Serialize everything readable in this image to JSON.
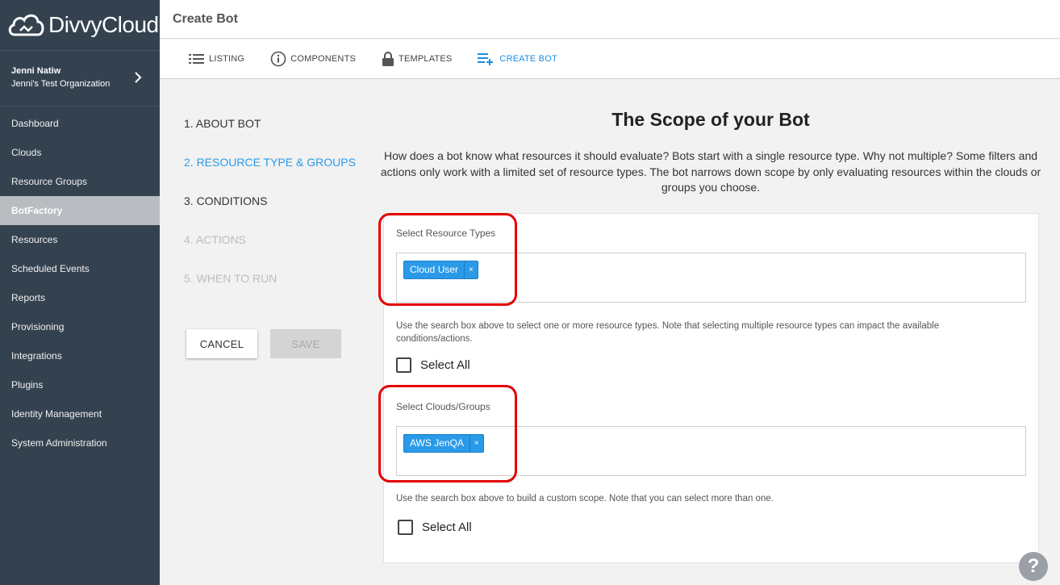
{
  "sidebar": {
    "logo_text": "DivvyCloud",
    "user_name": "Jenni Natiw",
    "user_org": "Jenni's Test Organization",
    "nav": [
      {
        "label": "Dashboard"
      },
      {
        "label": "Clouds"
      },
      {
        "label": "Resource Groups"
      },
      {
        "label": "BotFactory"
      },
      {
        "label": "Resources"
      },
      {
        "label": "Scheduled Events"
      },
      {
        "label": "Reports"
      },
      {
        "label": "Provisioning"
      },
      {
        "label": "Integrations"
      },
      {
        "label": "Plugins"
      },
      {
        "label": "Identity Management"
      },
      {
        "label": "System Administration"
      }
    ],
    "active_item": "BotFactory"
  },
  "header": {
    "title": "Create Bot"
  },
  "tabs": [
    {
      "label": "LISTING",
      "icon": "list-icon"
    },
    {
      "label": "COMPONENTS",
      "icon": "info-icon"
    },
    {
      "label": "TEMPLATES",
      "icon": "lock-icon"
    },
    {
      "label": "CREATE BOT",
      "icon": "add-list-icon"
    }
  ],
  "active_tab": "CREATE BOT",
  "steps": [
    {
      "label": "1. ABOUT BOT",
      "state": "done"
    },
    {
      "label": "2. RESOURCE TYPE & GROUPS",
      "state": "active"
    },
    {
      "label": "3. CONDITIONS",
      "state": "done"
    },
    {
      "label": "4. ACTIONS",
      "state": "disabled"
    },
    {
      "label": "5. WHEN TO RUN",
      "state": "disabled"
    }
  ],
  "buttons": {
    "cancel": "CANCEL",
    "save": "SAVE"
  },
  "main": {
    "title": "The Scope of your Bot",
    "description": "How does a bot know what resources it should evaluate? Bots start with a single resource type. Why not multiple? Some filters and actions only work with a limited set of resource types. The bot narrows down scope by only evaluating resources within the clouds or groups you choose."
  },
  "resource_types": {
    "label": "Select Resource Types",
    "chips": [
      "Cloud User"
    ],
    "help": "Use the search box above to select one or more resource types. Note that selecting multiple resource types can impact the available conditions/actions.",
    "select_all": "Select All"
  },
  "clouds": {
    "label": "Select Clouds/Groups",
    "chips": [
      "AWS JenQA"
    ],
    "help": "Use the search box above to build a custom scope. Note that you can select more than one.",
    "select_all": "Select All"
  },
  "colors": {
    "accent": "#2a9ae8",
    "sidebar": "#344250",
    "highlight": "#e30000"
  },
  "help_button": "?"
}
